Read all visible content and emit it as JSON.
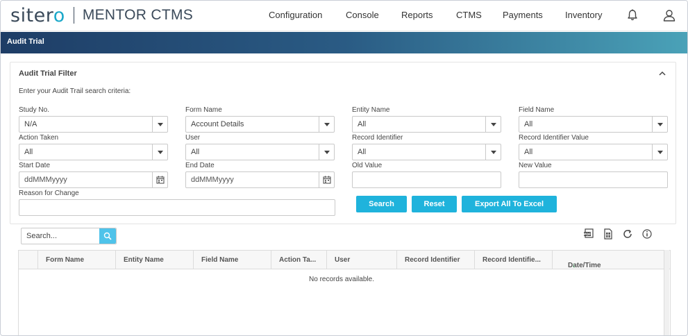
{
  "logo": {
    "brand_main": "siter",
    "brand_accent": "o",
    "product": "MENTOR CTMS"
  },
  "nav": {
    "items": [
      "Configuration",
      "Console",
      "Reports",
      "CTMS",
      "Payments",
      "Inventory"
    ],
    "icons": [
      "bell-icon",
      "user-icon"
    ]
  },
  "page": {
    "title": "Audit Trial"
  },
  "filter": {
    "title": "Audit Trial Filter",
    "instructions": "Enter your Audit Trail search criteria:",
    "fields": {
      "study_no": {
        "label": "Study No.",
        "value": "N/A"
      },
      "form_name": {
        "label": "Form Name",
        "value": "Account Details"
      },
      "entity_name": {
        "label": "Entity Name",
        "value": "All"
      },
      "field_name": {
        "label": "Field Name",
        "value": "All"
      },
      "action_taken": {
        "label": "Action Taken",
        "value": "All"
      },
      "user": {
        "label": "User",
        "value": "All"
      },
      "record_identifier": {
        "label": "Record Identifier",
        "value": "All"
      },
      "record_identifier_value": {
        "label": "Record Identifier Value",
        "value": "All"
      },
      "start_date": {
        "label": "Start Date",
        "placeholder": "ddMMMyyyy"
      },
      "end_date": {
        "label": "End Date",
        "placeholder": "ddMMMyyyy"
      },
      "old_value": {
        "label": "Old Value",
        "value": ""
      },
      "new_value": {
        "label": "New Value",
        "value": ""
      },
      "reason_for_change": {
        "label": "Reason for Change",
        "value": ""
      }
    },
    "buttons": {
      "search": "Search",
      "reset": "Reset",
      "export": "Export All To Excel"
    }
  },
  "grid": {
    "search_placeholder": "Search...",
    "toolbar_icons": [
      "pdf-icon",
      "excel-icon",
      "refresh-icon",
      "info-icon"
    ],
    "columns": [
      "Form Name",
      "Entity Name",
      "Field Name",
      "Action Ta...",
      "User",
      "Record Identifier",
      "Record Identifie...",
      "Date/Time"
    ],
    "sort_indicator": "↓",
    "empty_message": "No records available."
  },
  "colors": {
    "accent": "#1fb3dc",
    "header_start": "#1e3d66",
    "header_end": "#4aa2b8",
    "logo_accent": "#1ba8c9"
  }
}
